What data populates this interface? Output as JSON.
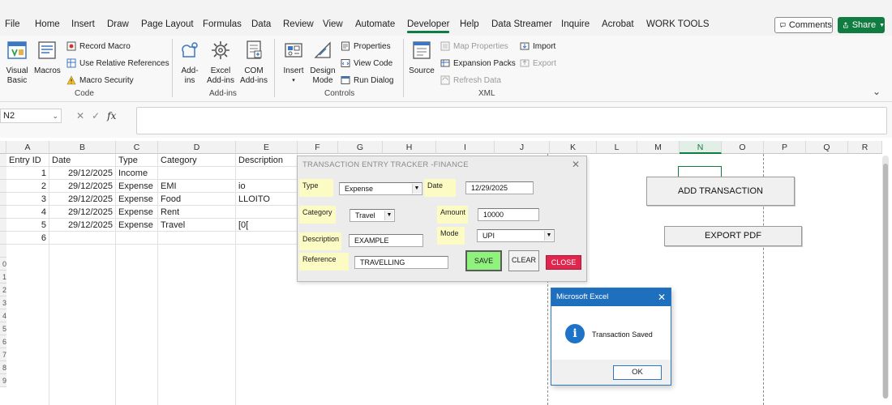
{
  "ribbon_tabs": [
    "File",
    "Home",
    "Insert",
    "Draw",
    "Page Layout",
    "Formulas",
    "Data",
    "Review",
    "View",
    "Automate",
    "Developer",
    "Help",
    "Data Streamer",
    "Inquire",
    "Acrobat",
    "WORK TOOLS"
  ],
  "active_tab": "Developer",
  "header_buttons": {
    "comments": "Comments",
    "share": "Share"
  },
  "ribbon": {
    "code": {
      "visual_basic": "Visual\nBasic",
      "macros": "Macros",
      "record_macro": "Record Macro",
      "relative_refs": "Use Relative References",
      "macro_security": "Macro Security",
      "label": "Code"
    },
    "addins": {
      "addins": "Add-\nins",
      "excel_addins": "Excel\nAdd-ins",
      "com_addins": "COM\nAdd-ins",
      "label": "Add-ins"
    },
    "controls": {
      "insert": "Insert",
      "design_mode": "Design\nMode",
      "properties": "Properties",
      "view_code": "View Code",
      "run_dialog": "Run Dialog",
      "label": "Controls"
    },
    "xml": {
      "source": "Source",
      "map_properties": "Map Properties",
      "expansion_packs": "Expansion Packs",
      "refresh_data": "Refresh Data",
      "import": "Import",
      "export": "Export",
      "label": "XML"
    }
  },
  "formula_bar": {
    "name_box": "N2",
    "fx": "fx",
    "value": ""
  },
  "columns": [
    "A",
    "B",
    "C",
    "D",
    "E",
    "F",
    "G",
    "H",
    "I",
    "J",
    "K",
    "L",
    "M",
    "N",
    "O",
    "P",
    "Q",
    "R"
  ],
  "selected_column": "N",
  "row_numbers": [
    "",
    "",
    "",
    "",
    "",
    "",
    "",
    "",
    "0",
    "1",
    "2",
    "3",
    "4",
    "5",
    "6",
    "7",
    "8",
    "9"
  ],
  "table": {
    "headers": [
      "Entry ID",
      "Date",
      "Type",
      "Category",
      "Description"
    ],
    "rows": [
      [
        "1",
        "29/12/2025",
        "Income",
        "",
        ""
      ],
      [
        "2",
        "29/12/2025",
        "Expense",
        "EMI",
        "io"
      ],
      [
        "3",
        "29/12/2025",
        "Expense",
        "Food",
        "LLOITO"
      ],
      [
        "4",
        "29/12/2025",
        "Expense",
        "Rent",
        ""
      ],
      [
        "5",
        "29/12/2025",
        "Expense",
        "Travel",
        "[0["
      ],
      [
        "6",
        "",
        "",
        "",
        ""
      ]
    ]
  },
  "sheet_buttons": {
    "add_transaction": "ADD TRANSACTION",
    "export_pdf": "EXPORT PDF"
  },
  "userform": {
    "title": "TRANSACTION ENTRY TRACKER -FINANCE",
    "labels": {
      "type": "Type",
      "date": "Date",
      "category": "Category",
      "amount": "Amount",
      "description": "Description",
      "mode": "Mode",
      "reference": "Reference"
    },
    "values": {
      "type": "Expense",
      "date": "12/29/2025",
      "category": "Travel",
      "amount": "10000",
      "description": "EXAMPLE",
      "mode": "UPI",
      "reference": "TRAVELLING"
    },
    "buttons": {
      "save": "SAVE",
      "clear": "CLEAR",
      "close": "CLOSE"
    },
    "colors": {
      "label_bg": "#fdfbc4",
      "save_bg": "#8ef27d",
      "close_bg": "#e0264f"
    }
  },
  "message_box": {
    "title": "Microsoft Excel",
    "text": "Transaction Saved",
    "ok": "OK",
    "icon": "info-icon"
  },
  "colors": {
    "accent": "#107c41",
    "dialog_blue": "#1f6fbf"
  }
}
